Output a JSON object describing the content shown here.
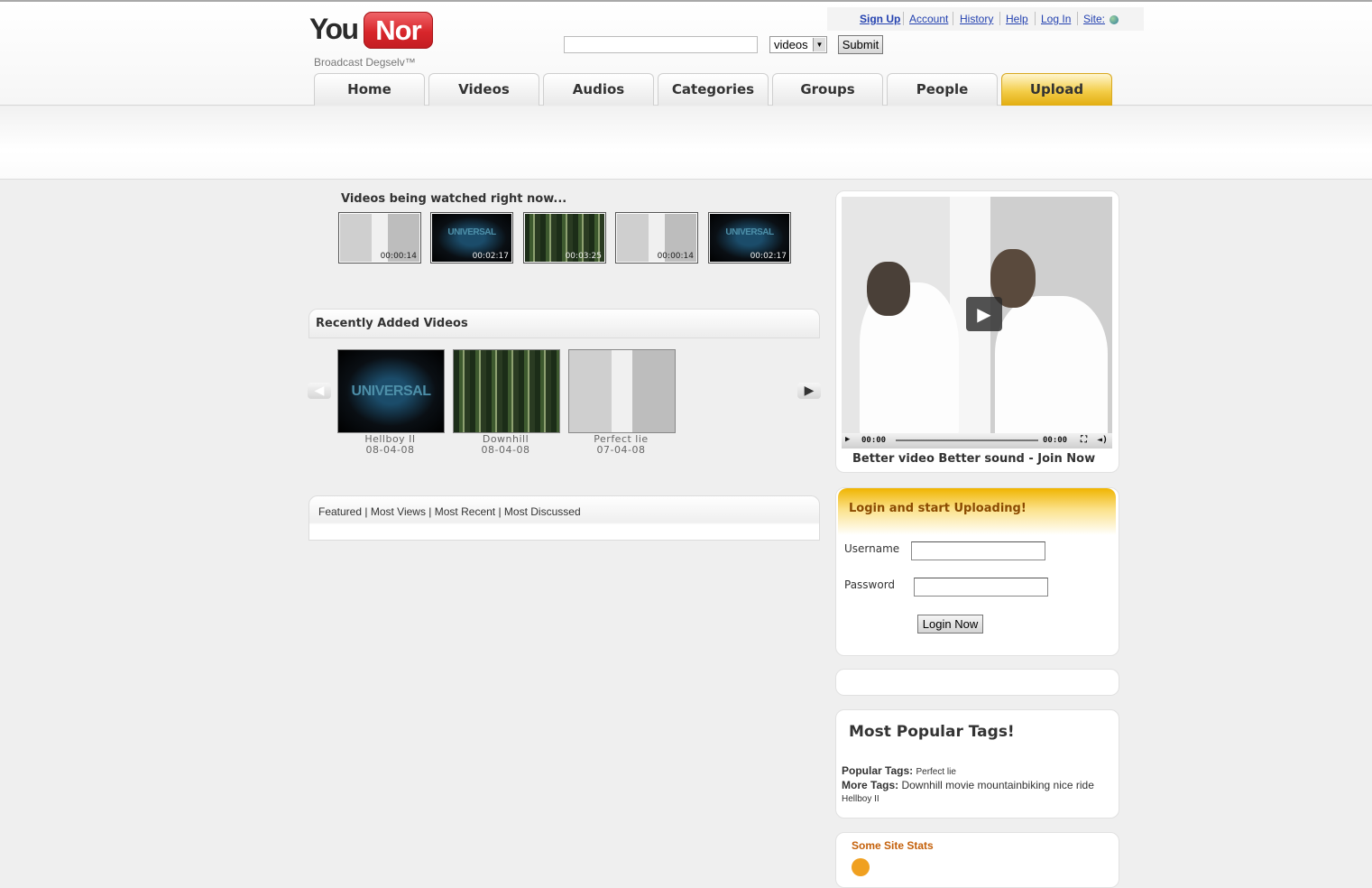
{
  "logo": {
    "you": "You",
    "nor": "Nor",
    "tagline": "Broadcast Degselv™"
  },
  "userlinks": {
    "signup": "Sign Up",
    "account": "Account",
    "history": "History",
    "help": "Help",
    "login": "Log In",
    "site": "Site:"
  },
  "search": {
    "value": "",
    "select_value": "videos",
    "submit_label": "Submit"
  },
  "nav": {
    "tabs": [
      "Home",
      "Videos",
      "Audios",
      "Categories",
      "Groups",
      "People",
      "Upload"
    ]
  },
  "watching": {
    "title": "Videos being watched right now...",
    "items": [
      {
        "scene": "wall",
        "time": "00:00:14"
      },
      {
        "scene": "universal",
        "time": "00:02:17"
      },
      {
        "scene": "forest",
        "time": "00:03:25"
      },
      {
        "scene": "wall",
        "time": "00:00:14"
      },
      {
        "scene": "universal",
        "time": "00:02:17"
      }
    ]
  },
  "recent": {
    "title": "Recently Added Videos",
    "universal_text": "UNIVERSAL",
    "items": [
      {
        "scene": "universal",
        "title": "Hellboy II",
        "date": "08-04-08"
      },
      {
        "scene": "forest",
        "title": "Downhill",
        "date": "08-04-08"
      },
      {
        "scene": "wall",
        "title": "Perfect lie",
        "date": "07-04-08"
      }
    ]
  },
  "feature_tabs": {
    "featured": "Featured",
    "most_views": "Most Views",
    "most_recent": "Most Recent",
    "most_discussed": "Most Discussed",
    "separator": " | "
  },
  "player": {
    "time_current": "00:00",
    "time_total": "00:00",
    "caption": "Better video Better sound - Join Now"
  },
  "login": {
    "title": "Login and start Uploading!",
    "username_label": "Username",
    "password_label": "Password",
    "button": "Login Now"
  },
  "tags": {
    "title": "Most Popular Tags!",
    "popular_label": "Popular Tags:",
    "popular": "Perfect lie",
    "more_label": "More Tags:",
    "more": "Downhill movie mountainbiking nice ride",
    "more2": "Hellboy II"
  },
  "stats": {
    "title": "Some Site Stats"
  },
  "colors": {
    "accent_gold": "#f0b400",
    "logo_red": "#d8262b",
    "link_blue": "#2442b0",
    "stats_orange": "#c4600a"
  }
}
